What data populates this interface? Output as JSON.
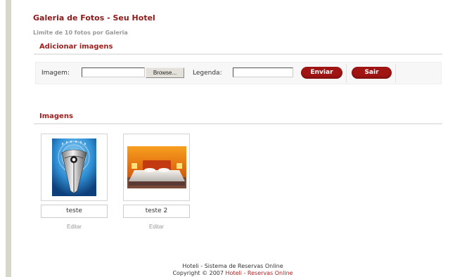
{
  "header": {
    "title": "Galeria de Fotos - Seu Hotel",
    "subtitle": "Limite de 10 fotos por Galeria"
  },
  "add_section": {
    "title": "Adicionar imagens",
    "image_label": "Imagem:",
    "file_value": "",
    "browse_label": "Browse...",
    "caption_label": "Legenda:",
    "caption_value": "",
    "send_label": "Enviar",
    "exit_label": "Sair"
  },
  "images_section": {
    "title": "Imagens",
    "items": [
      {
        "caption": "teste",
        "edit_label": "Editar",
        "icon": "fountain-pen-photo"
      },
      {
        "caption": "teste 2",
        "edit_label": "Editar",
        "icon": "hotel-bed-photo"
      }
    ]
  },
  "footer": {
    "line1": "Hoteli - Sistema de Reservas Online",
    "copyright_prefix": "Copyright © 2007 ",
    "copyright_link": "Hoteli - Reservas Online"
  },
  "colors": {
    "accent": "#a01414",
    "title": "#8a1a1a",
    "sidebar": "#d8d7cc"
  }
}
